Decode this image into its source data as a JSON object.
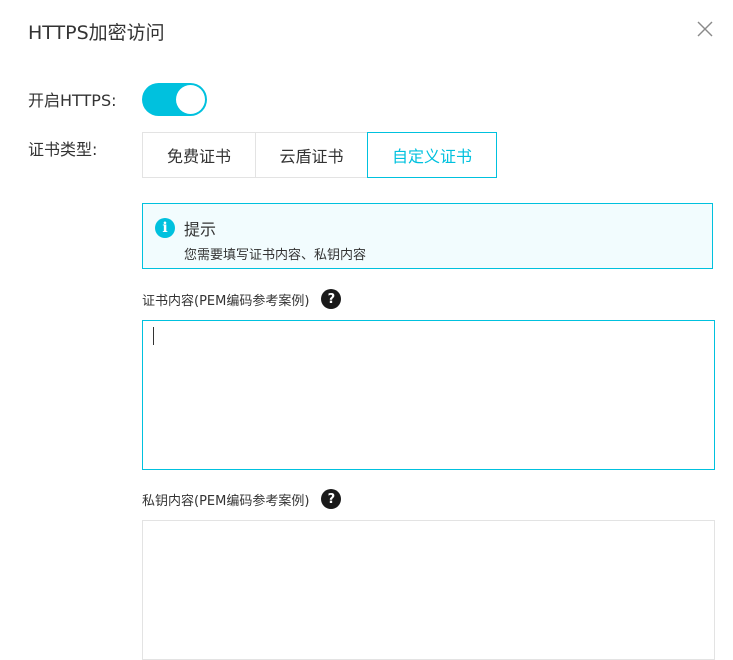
{
  "dialog": {
    "title": "HTTPS加密访问",
    "close_icon": "close-icon"
  },
  "https_toggle": {
    "label": "开启HTTPS:",
    "on": true,
    "color": "#00c1de"
  },
  "cert_type": {
    "label": "证书类型:",
    "options": [
      "免费证书",
      "云盾证书",
      "自定义证书"
    ],
    "selected": "自定义证书"
  },
  "tip": {
    "icon": "info-icon",
    "title": "提示",
    "message": "您需要填写证书内容、私钥内容"
  },
  "cert_content": {
    "label": "证书内容(PEM编码参考案例)",
    "help_icon": "question-icon",
    "value": ""
  },
  "private_key": {
    "label": "私钥内容(PEM编码参考案例)",
    "help_icon": "question-icon",
    "value": ""
  }
}
